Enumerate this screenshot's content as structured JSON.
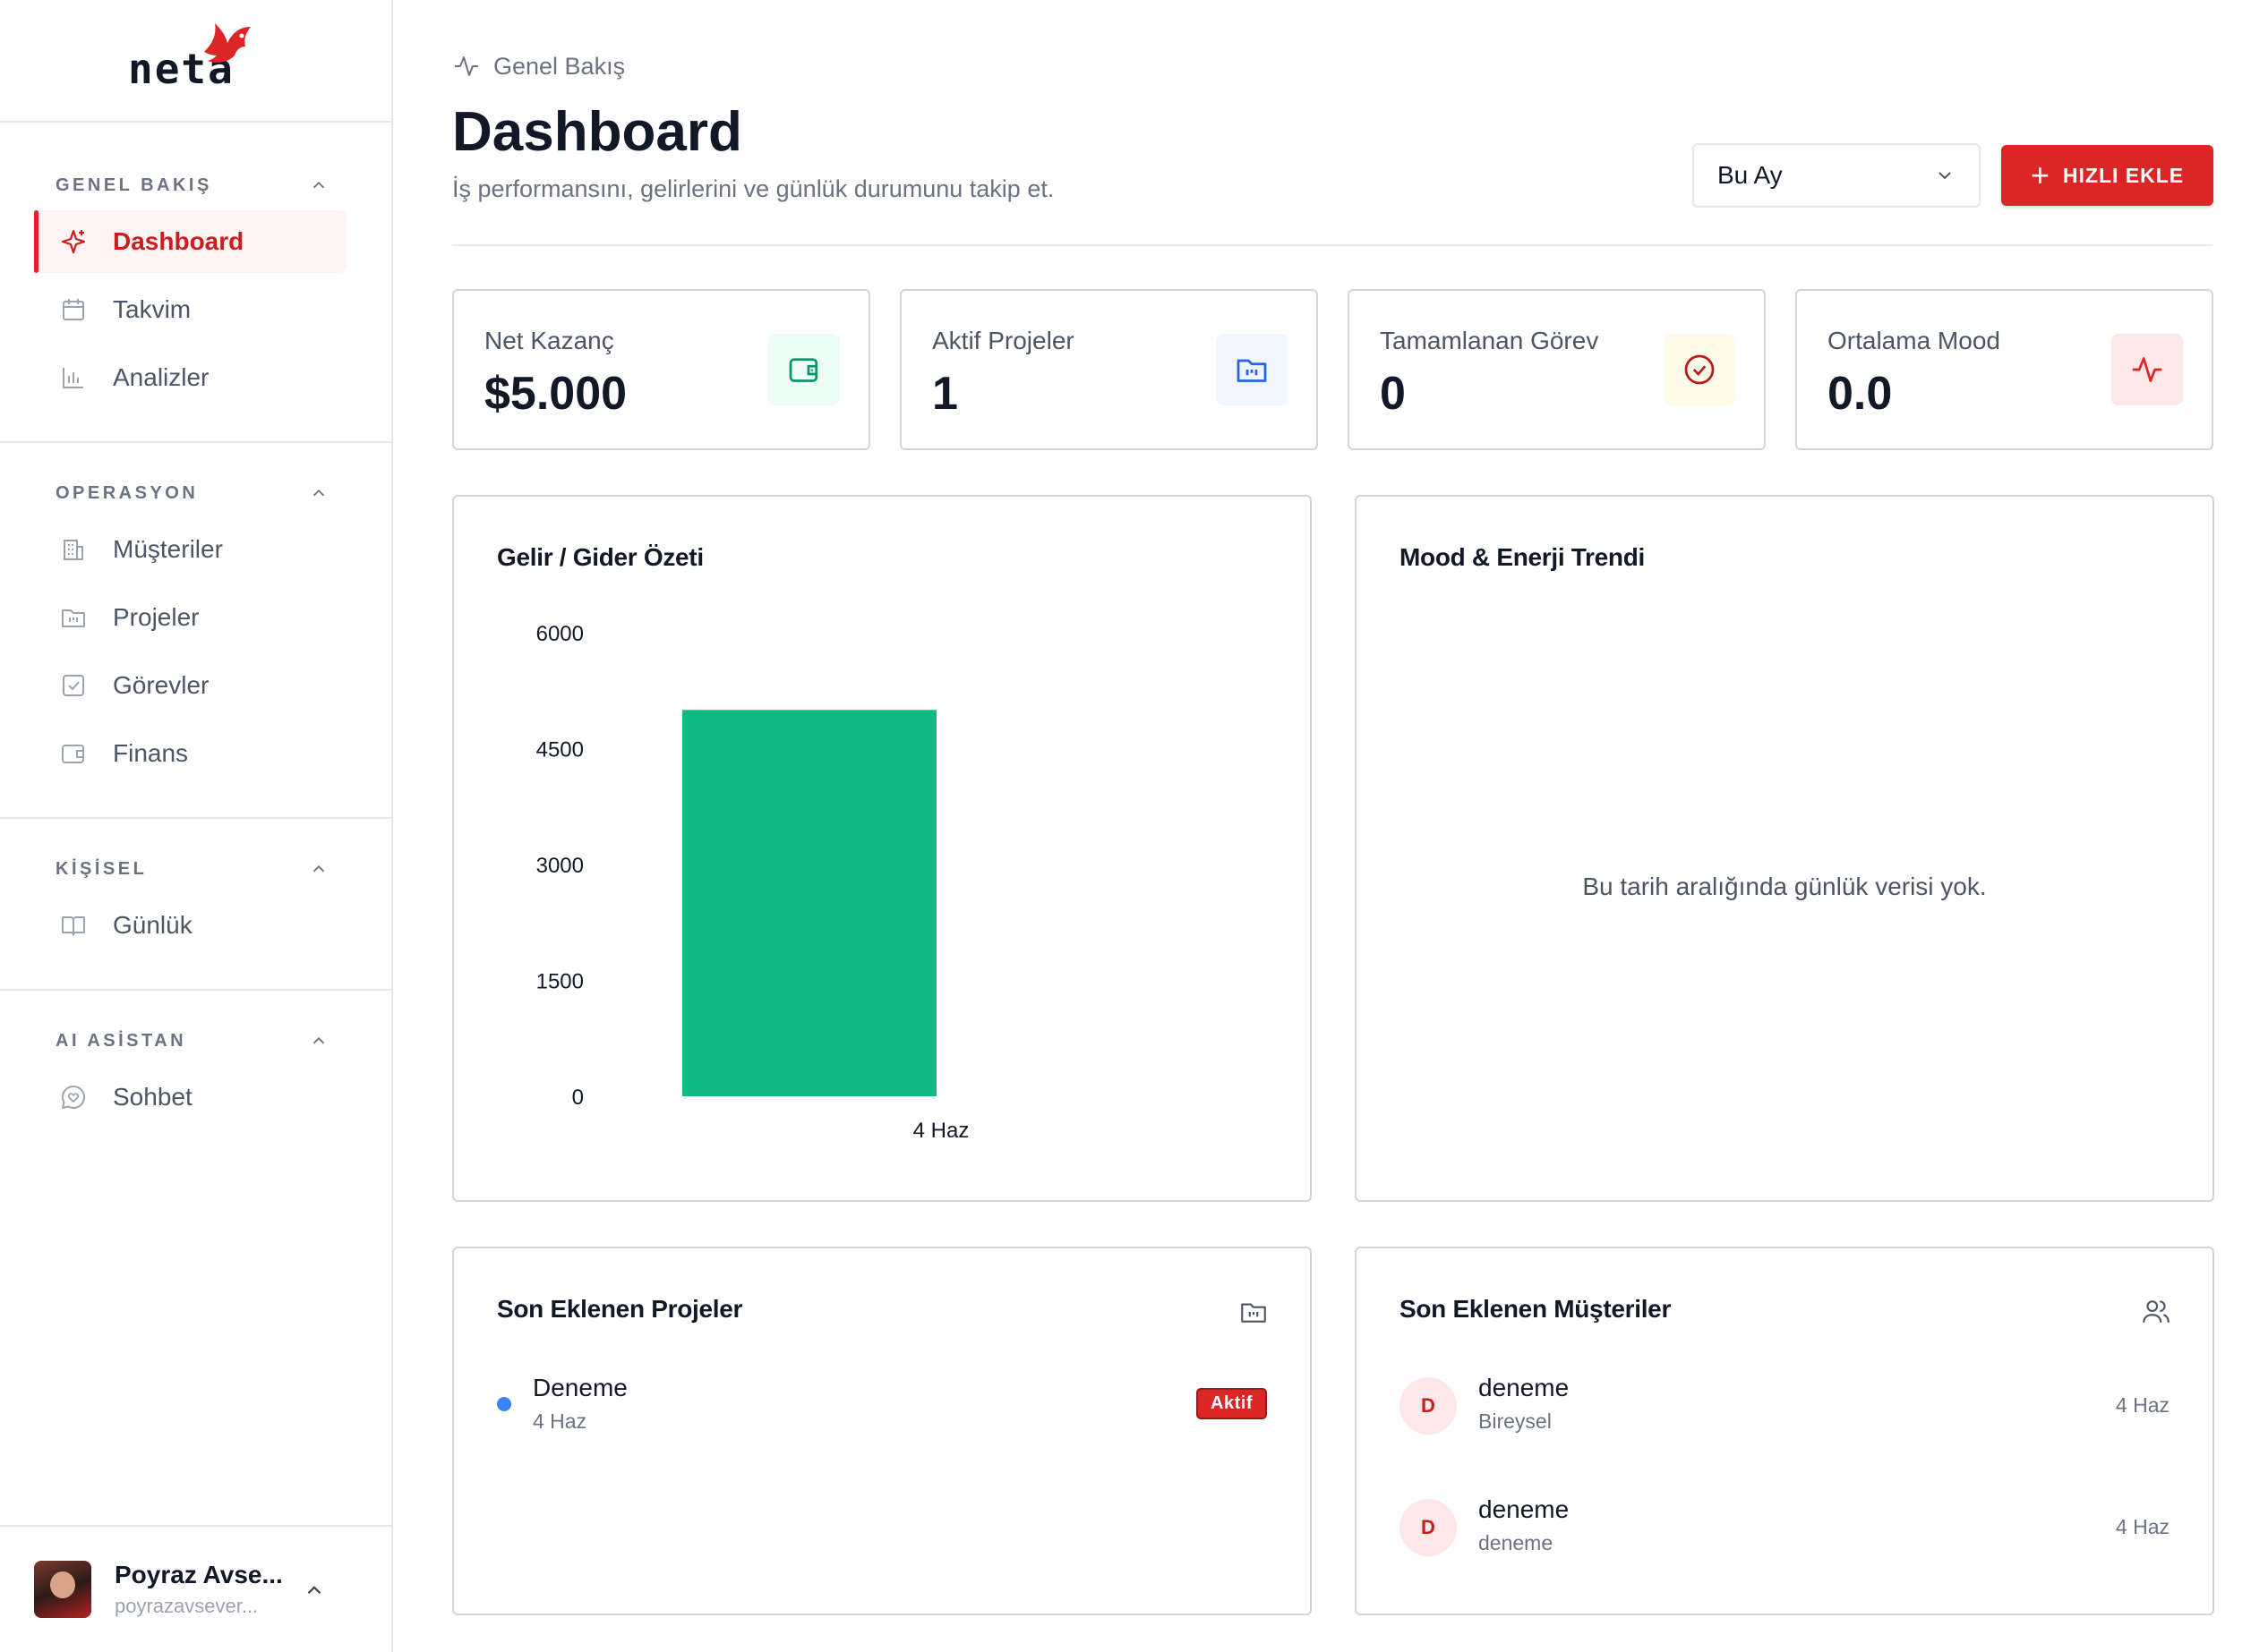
{
  "app": {
    "logo_text": "neta"
  },
  "sidebar": {
    "sections": [
      {
        "title": "GENEL BAKIŞ",
        "items": [
          {
            "label": "Dashboard",
            "icon": "sparkle-icon",
            "active": true
          },
          {
            "label": "Takvim",
            "icon": "calendar-icon"
          },
          {
            "label": "Analizler",
            "icon": "bar-chart-icon"
          }
        ]
      },
      {
        "title": "OPERASYON",
        "items": [
          {
            "label": "Müşteriler",
            "icon": "building-icon"
          },
          {
            "label": "Projeler",
            "icon": "folder-icon"
          },
          {
            "label": "Görevler",
            "icon": "check-square-icon"
          },
          {
            "label": "Finans",
            "icon": "wallet-icon"
          }
        ]
      },
      {
        "title": "KİŞİSEL",
        "items": [
          {
            "label": "Günlük",
            "icon": "book-open-icon"
          }
        ]
      },
      {
        "title": "AI ASİSTAN",
        "items": [
          {
            "label": "Sohbet",
            "icon": "chat-heart-icon"
          }
        ]
      }
    ],
    "user": {
      "name": "Poyraz Avse...",
      "email": "poyrazavsever..."
    }
  },
  "header": {
    "breadcrumb": "Genel Bakış",
    "title": "Dashboard",
    "subtitle": "İş performansını, gelirlerini ve günlük durumunu takip et.",
    "period_select": "Bu Ay",
    "quick_add_label": "HIZLI EKLE"
  },
  "stats": [
    {
      "label": "Net Kazanç",
      "value": "$5.000",
      "icon": "wallet-icon",
      "color": "#059669",
      "bg": "#ecfdf5"
    },
    {
      "label": "Aktif Projeler",
      "value": "1",
      "icon": "folder-icon",
      "color": "#2563eb",
      "bg": "#eff6ff"
    },
    {
      "label": "Tamamlanan Görev",
      "value": "0",
      "icon": "check-circle-icon",
      "color": "#b91c1c",
      "bg": "#fefce8"
    },
    {
      "label": "Ortalama Mood",
      "value": "0.0",
      "icon": "activity-icon",
      "color": "#dc2626",
      "bg": "#fde8e8"
    }
  ],
  "income_card": {
    "title": "Gelir / Gider Özeti"
  },
  "mood_card": {
    "title": "Mood & Enerji Trendi",
    "empty_message": "Bu tarih aralığında günlük verisi yok."
  },
  "chart_data": {
    "type": "bar",
    "title": "Gelir / Gider Özeti",
    "categories": [
      "4 Haz"
    ],
    "series": [
      {
        "values": [
          5000
        ],
        "color": "#10b981"
      }
    ],
    "yticks": [
      "6000",
      "4500",
      "3000",
      "1500",
      "0"
    ],
    "ylim": [
      0,
      6000
    ],
    "grid": false,
    "legend": "none"
  },
  "projects_card": {
    "title": "Son Eklenen Projeler",
    "items": [
      {
        "title": "Deneme",
        "date": "4 Haz",
        "status": "Aktif"
      }
    ]
  },
  "customers_card": {
    "title": "Son Eklenen Müşteriler",
    "items": [
      {
        "initial": "D",
        "name": "deneme",
        "type": "Bireysel",
        "date": "4 Haz"
      },
      {
        "initial": "D",
        "name": "deneme",
        "type": "deneme",
        "date": "4 Haz"
      }
    ]
  }
}
